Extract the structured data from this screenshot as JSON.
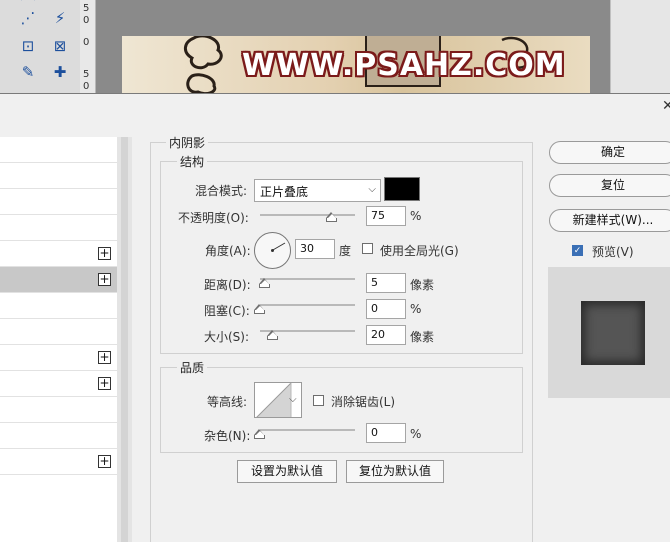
{
  "ruler": {
    "marks": [
      "5",
      "0",
      "0",
      "5",
      "0"
    ]
  },
  "canvas": {
    "watermark": "WWW.PSAHZ.COM"
  },
  "icons": {
    "lasso": "lasso-icon",
    "magic_wand": "magic-wand-icon",
    "crop": "crop-icon",
    "frame": "frame-icon",
    "eyedropper": "eyedropper-icon",
    "healing": "healing-brush-icon",
    "close": "close-icon",
    "plus": "plus-icon",
    "checkbox_check": "check-icon"
  },
  "style_list": {
    "rows": [
      {
        "label": "",
        "has_plus": false,
        "active": false
      },
      {
        "label": "",
        "has_plus": false,
        "active": false
      },
      {
        "label": "",
        "has_plus": false,
        "active": false
      },
      {
        "label": "",
        "has_plus": false,
        "active": false
      },
      {
        "label": "",
        "has_plus": true,
        "active": false
      },
      {
        "label": "",
        "has_plus": true,
        "active": true
      },
      {
        "label": "",
        "has_plus": false,
        "active": false
      },
      {
        "label": "",
        "has_plus": false,
        "active": false
      },
      {
        "label": "",
        "has_plus": true,
        "active": false
      },
      {
        "label": "",
        "has_plus": true,
        "active": false
      },
      {
        "label": "",
        "has_plus": false,
        "active": false
      },
      {
        "label": "",
        "has_plus": false,
        "active": false
      },
      {
        "label": "",
        "has_plus": true,
        "active": false
      }
    ],
    "plus_symbol": "+"
  },
  "panel": {
    "title": "内阴影",
    "structure": {
      "legend": "结构",
      "blend_mode_label": "混合模式:",
      "blend_mode_value": "正片叠底",
      "blend_mode_arrow": "⌵",
      "opacity_label": "不透明度(O):",
      "opacity_value": "75",
      "opacity_unit": "%",
      "opacity_level": 0.75,
      "angle_label": "角度(A):",
      "angle_value": "30",
      "angle_unit": "度",
      "global_light_label": "使用全局光(G)",
      "global_light_checked": false,
      "distance_label": "距离(D):",
      "distance_value": "5",
      "distance_unit": "像素",
      "choke_label": "阻塞(C):",
      "choke_value": "0",
      "choke_unit": "%",
      "size_label": "大小(S):",
      "size_value": "20",
      "size_unit": "像素",
      "shadow_color": "#000000"
    },
    "quality": {
      "legend": "品质",
      "contour_label": "等高线:",
      "contour_arrow": "⌵",
      "antialias_label": "消除锯齿(L)",
      "antialias_checked": false,
      "noise_label": "杂色(N):",
      "noise_value": "0",
      "noise_unit": "%"
    },
    "make_default_label": "设置为默认值",
    "reset_default_label": "复位为默认值"
  },
  "actions": {
    "ok_label": "确定",
    "reset_label": "复位",
    "new_style_label": "新建样式(W)...",
    "preview_label": "预览(V)",
    "preview_checked": true
  }
}
